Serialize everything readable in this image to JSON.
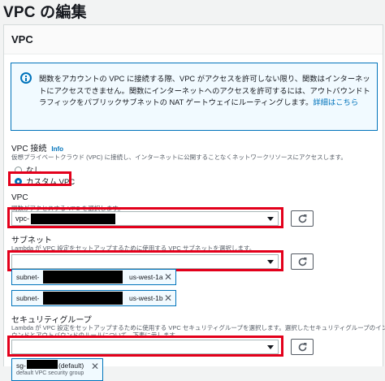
{
  "page": {
    "title": "VPC の編集"
  },
  "panel": {
    "header": "VPC"
  },
  "info": {
    "text": "関数をアカウントの VPC に接続する際、VPC がアクセスを許可しない限り、関数はインターネットにアクセスできません。関数にインターネットへのアクセスを許可するには、アウトバウンドトラフィックをパブリックサブネットの NAT ゲートウェイにルーティングします。",
    "link": "詳細はこちら"
  },
  "vpc_connection": {
    "label": "VPC 接続",
    "info_tag": "Info",
    "description": "仮想プライベートクラウド (VPC) に接続し、インターネットに公開することなくネットワークリソースにアクセスします。",
    "options": [
      {
        "label": "なし",
        "selected": false
      },
      {
        "label": "カスタム VPC",
        "selected": true
      }
    ]
  },
  "vpc": {
    "label": "VPC",
    "description": "関数がアクセスする VPC を選択します。",
    "value": "vpc-"
  },
  "subnets": {
    "label": "サブネット",
    "description": "Lambda が VPC 設定をセットアップするために使用する VPC サブネットを選択します。",
    "value": "",
    "tokens": [
      {
        "prefix": "subnet-",
        "suffix": "us-west-1a"
      },
      {
        "prefix": "subnet-",
        "suffix": "us-west-1b"
      }
    ]
  },
  "security_groups": {
    "label": "セキュリティグループ",
    "description_line1": "Lambda が VPC 設定をセットアップするために使用する VPC セキュリティグループを選択します。選択したセキュリティグループのインバ",
    "description_line2": "ウンドとアウトバウンドのルールについて、下表に示します。",
    "value": "",
    "tokens": [
      {
        "prefix": "sg-",
        "suffix": "(default)",
        "subtitle": "default VPC security group"
      }
    ]
  },
  "colors": {
    "accent": "#0073bb",
    "highlight": "#e3001b",
    "redaction": "#000000"
  },
  "icons": {
    "info": "info-circle-icon",
    "refresh": "refresh-icon",
    "remove": "close-icon",
    "dropdown": "caret-down-icon"
  }
}
